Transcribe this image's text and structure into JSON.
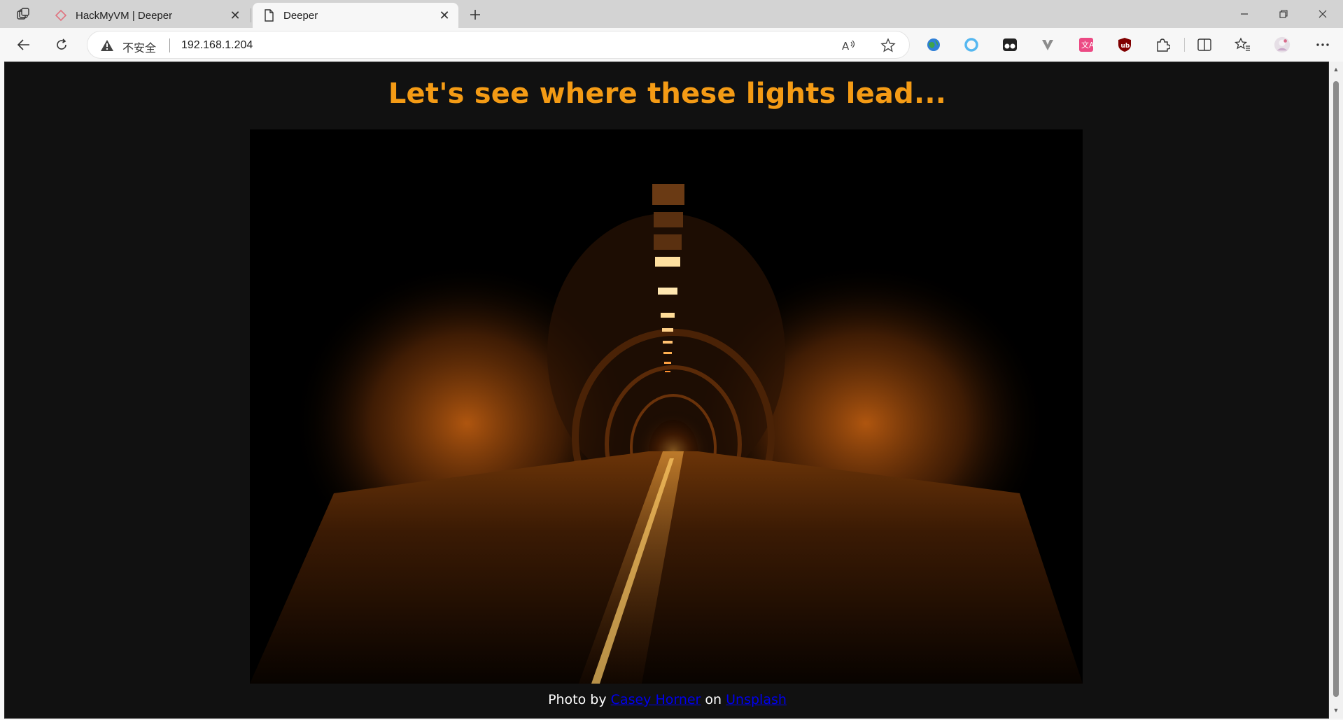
{
  "browser": {
    "tabs": [
      {
        "title": "HackMyVM | Deeper",
        "active": false
      },
      {
        "title": "Deeper",
        "active": true
      }
    ],
    "address": {
      "security_label": "不安全",
      "url": "192.168.1.204"
    },
    "extensions": [
      "globe-extension-icon",
      "ring-extension-icon",
      "binoculars-extension-icon",
      "v-extension-icon",
      "translate-extension-icon",
      "ublock-extension-icon"
    ]
  },
  "page": {
    "heading": "Let's see where these lights lead...",
    "credit": {
      "prefix": "Photo by",
      "author": "Casey Horner",
      "middle": "on",
      "site": "Unsplash"
    }
  },
  "colors": {
    "heading": "#f49b15",
    "background": "#111111",
    "link": "#0000ee"
  }
}
